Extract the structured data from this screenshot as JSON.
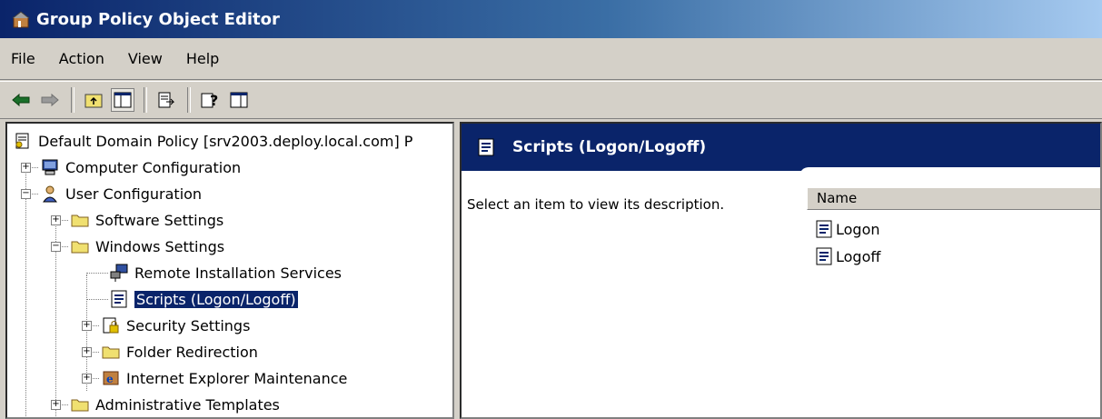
{
  "window": {
    "title": "Group Policy Object Editor"
  },
  "menu": {
    "items": [
      "File",
      "Action",
      "View",
      "Help"
    ]
  },
  "toolbar": {
    "buttons": [
      "back-icon",
      "forward-icon",
      "up-folder-icon",
      "show-hide-tree-icon",
      "export-list-icon",
      "help-icon",
      "show-hide-action-pane-icon"
    ]
  },
  "tree": {
    "root": "Default Domain Policy [srv2003.deploy.local.com] P",
    "computer_config": "Computer Configuration",
    "user_config": "User Configuration",
    "software_settings": "Software Settings",
    "windows_settings": "Windows Settings",
    "remote_install": "Remote Installation Services",
    "scripts": "Scripts (Logon/Logoff)",
    "security_settings": "Security Settings",
    "folder_redirection": "Folder Redirection",
    "ie_maintenance": "Internet Explorer Maintenance",
    "admin_templates": "Administrative Templates"
  },
  "details": {
    "header": "Scripts (Logon/Logoff)",
    "description": "Select an item to view its description.",
    "column_name": "Name",
    "items": [
      "Logon",
      "Logoff"
    ]
  },
  "colors": {
    "title_gradient_start": "#0a246a",
    "selection": "#0a246a",
    "face": "#d4d0c8"
  }
}
